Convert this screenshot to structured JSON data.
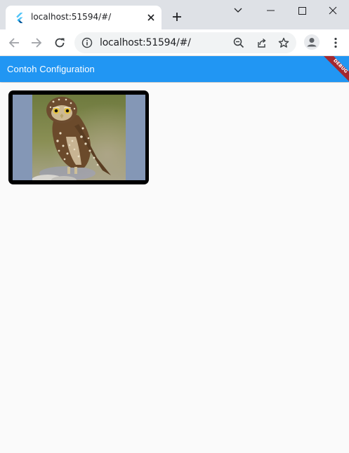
{
  "browser": {
    "tab": {
      "title": "localhost:51594/#/",
      "favicon": "flutter-icon"
    },
    "new_tab_icon": "plus-icon",
    "window_controls": [
      "chevron-down-icon",
      "minimize-icon",
      "maximize-icon",
      "close-icon"
    ],
    "address_bar": {
      "url": "localhost:51594/#/",
      "site_info_icon": "info-icon"
    },
    "toolbar_icons": [
      "zoom-icon",
      "share-icon",
      "star-icon",
      "profile-icon",
      "menu-icon"
    ]
  },
  "app": {
    "appbar": {
      "title": "Contoh Configuration",
      "color": "#2196f3"
    },
    "debug_banner": {
      "label": "DEBUG",
      "color": "#b71c1c"
    },
    "image": {
      "description_icon": "owl-image",
      "border_color": "#000000",
      "background_color": "#8497b6"
    }
  }
}
